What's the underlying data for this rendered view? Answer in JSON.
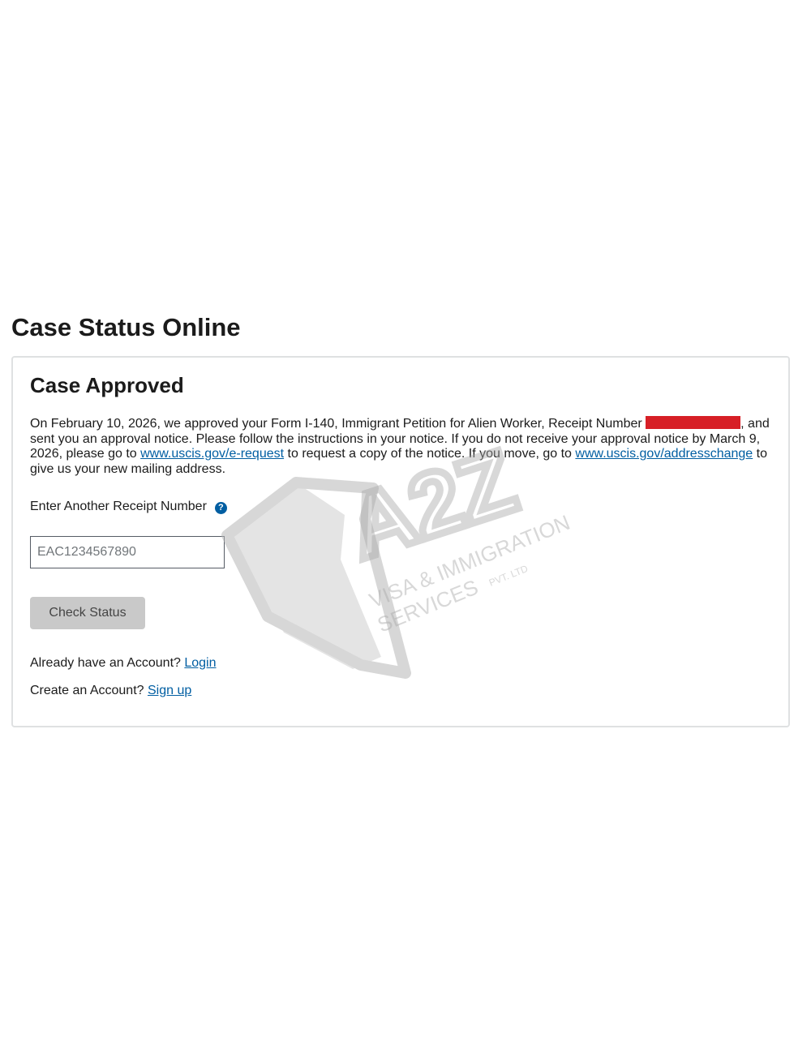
{
  "page": {
    "title": "Case Status Online"
  },
  "case": {
    "heading": "Case Approved",
    "text_part1": "On February 10, 2026, we approved your Form I-140, Immigrant Petition for Alien Worker, Receipt Number ",
    "text_part2": ", and sent you an approval notice. Please follow the instructions in your notice. If you do not receive your approval notice by March 9, 2026, please go to ",
    "link_erequest": "www.uscis.gov/e-request",
    "text_part3": " to request a copy of the notice. If you move, go to ",
    "link_addresschange": "www.uscis.gov/addresschange",
    "text_part4": " to give us your new mailing address.",
    "redaction_color": "#d71f26"
  },
  "form": {
    "label": "Enter Another Receipt Number",
    "help_glyph": "?",
    "input_placeholder": "EAC1234567890",
    "button_label": "Check Status"
  },
  "account": {
    "login_prompt": "Already have an Account?",
    "login_link": "Login",
    "signup_prompt": "Create an Account?",
    "signup_link": "Sign up"
  },
  "watermark": {
    "brand": "A2Z",
    "line1": "VISA & IMMIGRATION",
    "line2": "SERVICES",
    "suffix": "PVT. LTD"
  },
  "colors": {
    "link": "#005ea2",
    "button_bg": "#c9c9c9",
    "border": "#dfe1e2"
  }
}
